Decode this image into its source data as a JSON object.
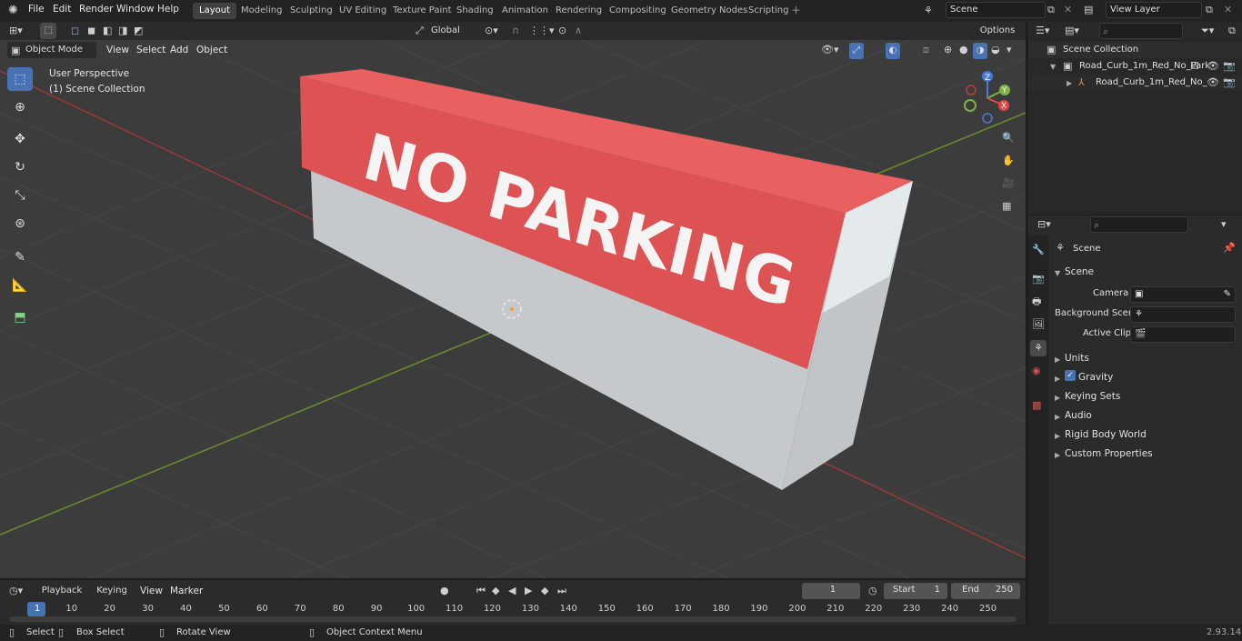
{
  "menu": {
    "items": [
      "File",
      "Edit",
      "Render",
      "Window",
      "Help"
    ]
  },
  "workspaces": [
    "Layout",
    "Modeling",
    "Sculpting",
    "UV Editing",
    "Texture Paint",
    "Shading",
    "Animation",
    "Rendering",
    "Compositing",
    "Geometry Nodes",
    "Scripting"
  ],
  "active_workspace": "Layout",
  "scene_name": "Scene",
  "view_layer": "View Layer",
  "header": {
    "mode": "Object Mode",
    "view": "View",
    "select": "Select",
    "add": "Add",
    "object": "Object",
    "transform": "Global",
    "options": "Options"
  },
  "viewport": {
    "perspective": "User Perspective",
    "collection": "(1) Scene Collection",
    "text_on_object": "NO PARKING"
  },
  "outliner": {
    "search": "",
    "root": "Scene Collection",
    "collection": "Road_Curb_1m_Red_No_Park",
    "object": "Road_Curb_1m_Red_No_"
  },
  "properties": {
    "search": "",
    "context": "Scene",
    "panel": "Scene",
    "camera_label": "Camera",
    "bg_label": "Background Scene",
    "clip_label": "Active Clip",
    "sections": [
      "Units",
      "Gravity",
      "Keying Sets",
      "Audio",
      "Rigid Body World",
      "Custom Properties"
    ]
  },
  "timeline": {
    "playback": "Playback",
    "keying": "Keying",
    "view": "View",
    "marker": "Marker",
    "current_frame": "1",
    "start_label": "Start",
    "start": "1",
    "end_label": "End",
    "end": "250",
    "ticks": [
      "1",
      "10",
      "20",
      "30",
      "40",
      "50",
      "60",
      "70",
      "80",
      "90",
      "100",
      "110",
      "120",
      "130",
      "140",
      "150",
      "160",
      "170",
      "180",
      "190",
      "200",
      "210",
      "220",
      "230",
      "240",
      "250"
    ]
  },
  "status": {
    "select": "Select",
    "box_select": "Box Select",
    "rotate": "Rotate View",
    "context_menu": "Object Context Menu",
    "version": "2.93.14"
  },
  "colors": {
    "accent": "#4772b3",
    "curb_red": "#d95050",
    "curb_white": "#c9ccce"
  }
}
